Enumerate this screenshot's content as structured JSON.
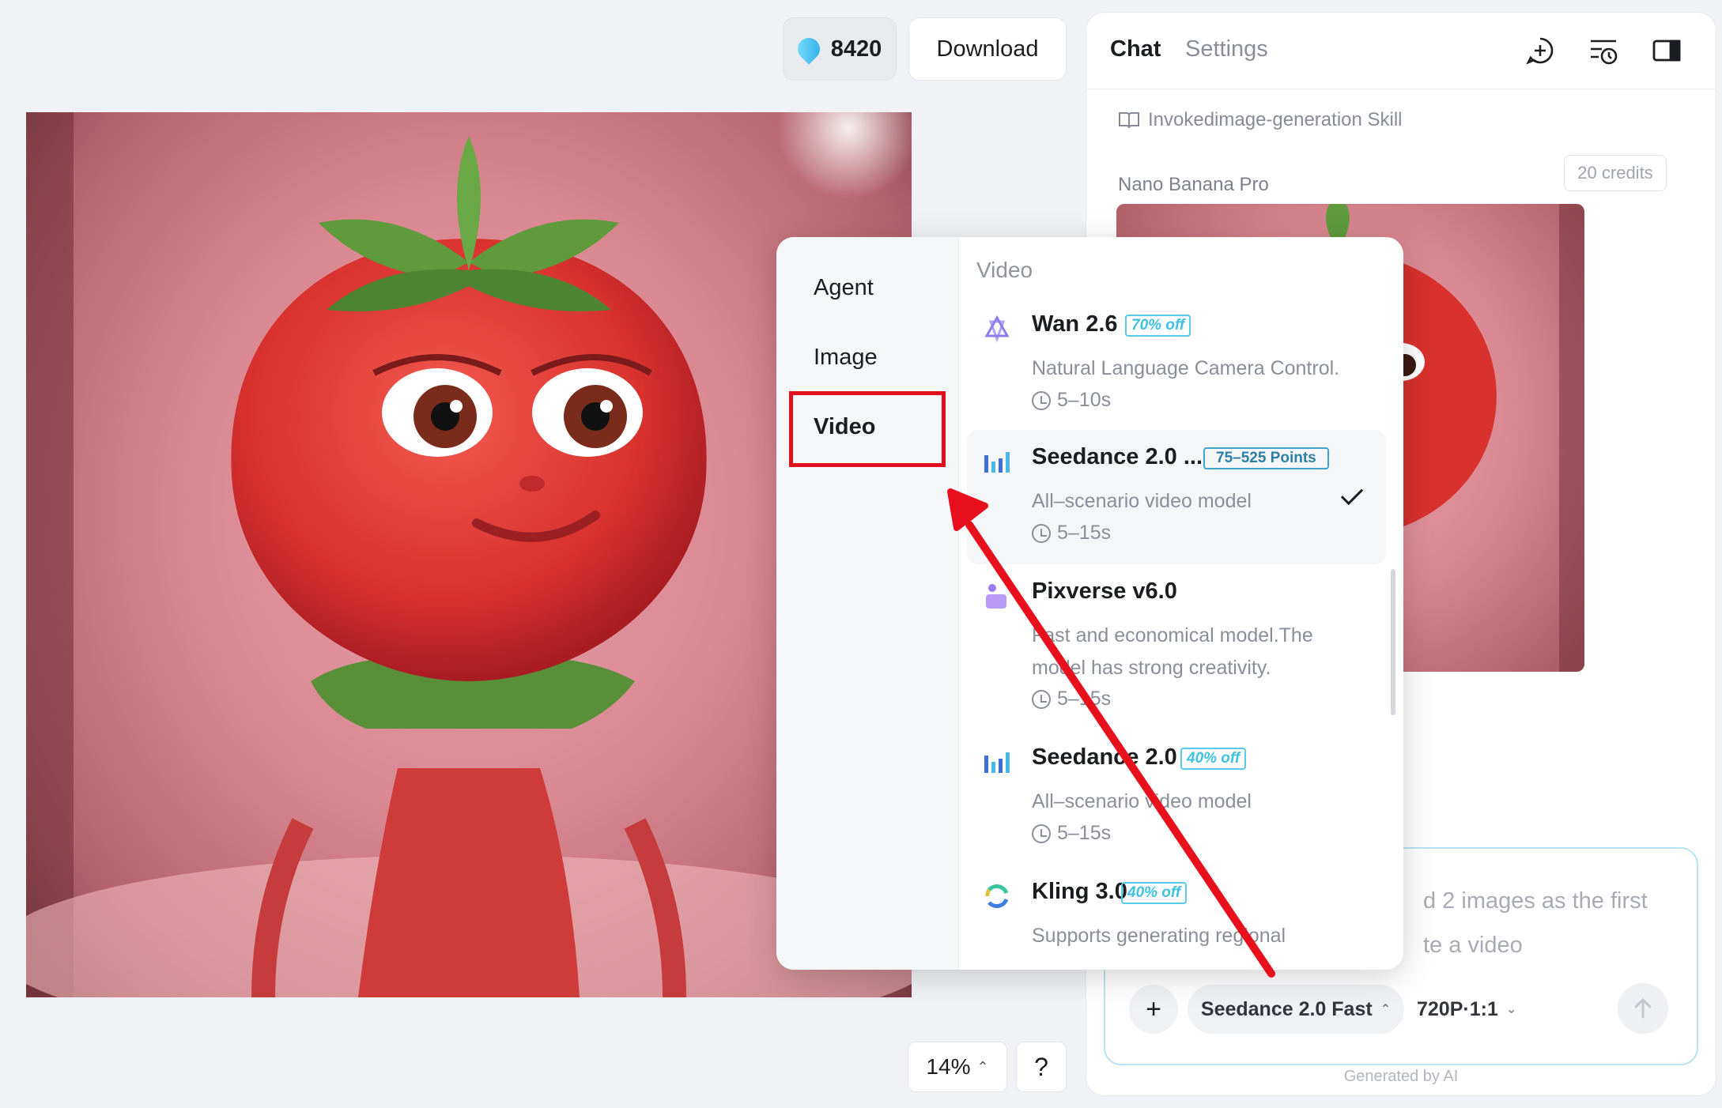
{
  "topbar": {
    "credits": "8420",
    "download_label": "Download"
  },
  "canvas": {
    "zoom": "14%",
    "help_label": "?"
  },
  "panel": {
    "tabs": [
      {
        "label": "Chat",
        "active": true
      },
      {
        "label": "Settings",
        "active": false
      }
    ],
    "header_icons": [
      "new-chat-icon",
      "history-icon",
      "sidebar-toggle-icon"
    ],
    "skill_text": "Invokedimage-generation Skill",
    "model_name": "Nano Banana Pro",
    "credits_tag": "20 credits",
    "composer": {
      "prompt_text": "Upload 2 images as the first and last frames to generate a video",
      "prompt_visible_line1": "d 2 images as the first",
      "prompt_visible_line2": "te a video",
      "model_select": "Seedance 2.0 Fast",
      "resolution_select": "720P·1:1"
    },
    "footer_note": "Generated by AI"
  },
  "dropdown": {
    "categories": [
      {
        "label": "Agent",
        "selected": false
      },
      {
        "label": "Image",
        "selected": false
      },
      {
        "label": "Video",
        "selected": true
      }
    ],
    "section_title": "Video",
    "items": [
      {
        "name": "Wan 2.6",
        "badge": "70% off",
        "desc": "Natural Language Camera Control.",
        "duration": "5–10s",
        "icon": "wan-logo-icon",
        "selected": false
      },
      {
        "name": "Seedance 2.0 ...",
        "badge": "75–525 Points",
        "desc": "All–scenario video model",
        "duration": "5–15s",
        "icon": "seedance-bars-icon",
        "selected": true
      },
      {
        "name": "Pixverse v6.0",
        "badge": "",
        "desc": "Fast and economical model.The model has strong creativity.",
        "duration": "5–15s",
        "icon": "pixverse-logo-icon",
        "selected": false
      },
      {
        "name": "Seedance 2.0",
        "badge": "40% off",
        "desc": "All–scenario video model",
        "duration": "5–15s",
        "icon": "seedance-bars-icon",
        "selected": false
      },
      {
        "name": "Kling 3.0",
        "badge": "40% off",
        "desc": "Supports generating regional",
        "duration": "",
        "icon": "kling-logo-icon",
        "selected": false
      }
    ]
  },
  "colors": {
    "highlight_box": "#e0101c",
    "annotation_arrow": "#e8101c",
    "badge_cyan": "#3fc1e2",
    "composer_border": "#b9e3f2"
  }
}
